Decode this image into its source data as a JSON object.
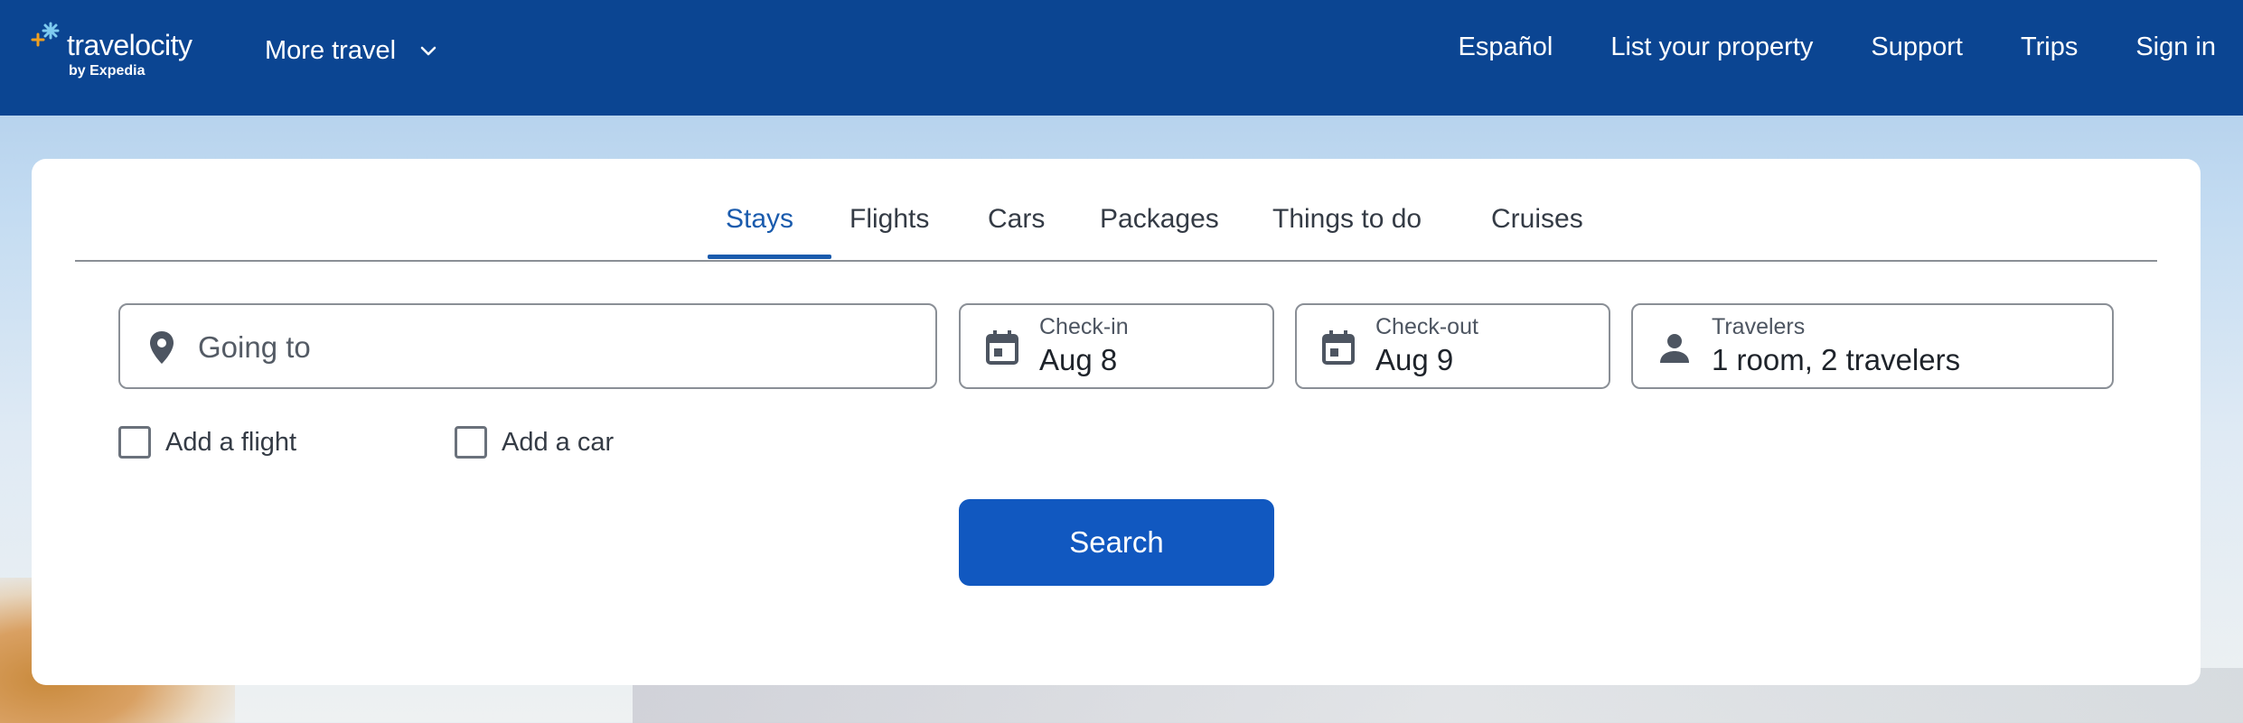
{
  "header": {
    "logo_text": "travelocity",
    "logo_sub": "by Expedia",
    "more_travel": "More travel",
    "nav": [
      "Español",
      "List your property",
      "Support",
      "Trips",
      "Sign in"
    ]
  },
  "tabs": [
    "Stays",
    "Flights",
    "Cars",
    "Packages",
    "Things to do",
    "Cruises"
  ],
  "active_tab": "Stays",
  "search": {
    "destination_placeholder": "Going to",
    "checkin_label": "Check-in",
    "checkin_value": "Aug 8",
    "checkout_label": "Check-out",
    "checkout_value": "Aug 9",
    "travelers_label": "Travelers",
    "travelers_value": "1 room, 2 travelers",
    "add_flight": "Add a flight",
    "add_car": "Add a car",
    "search_button": "Search"
  },
  "colors": {
    "header_bg": "#0b4592",
    "accent": "#1a5bad",
    "button_bg": "#1158c0"
  }
}
